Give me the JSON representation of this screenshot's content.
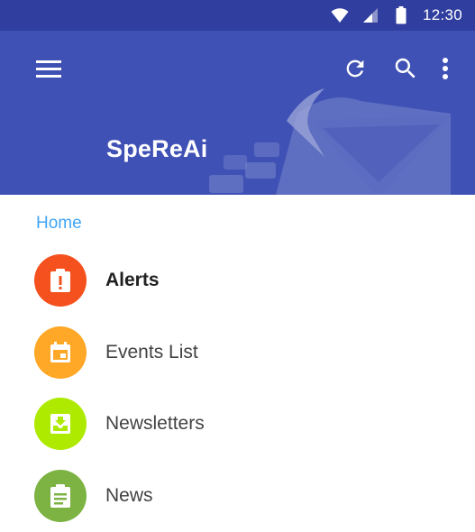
{
  "status_bar": {
    "time": "12:30",
    "icons": [
      "wifi-icon",
      "cell-signal-icon",
      "battery-icon"
    ]
  },
  "app_bar": {
    "title": "SpeReAi",
    "icons": [
      "menu-icon",
      "refresh-icon",
      "search-icon",
      "more-vert-icon"
    ]
  },
  "drawer": {
    "section_label": "Home",
    "items": [
      {
        "label": "Alerts",
        "icon": "alert-clipboard-icon",
        "color": "#f4511e",
        "active": true
      },
      {
        "label": "Events List",
        "icon": "calendar-icon",
        "color": "#ffa726",
        "active": false
      },
      {
        "label": "Newsletters",
        "icon": "inbox-download-icon",
        "color": "#aeea00",
        "active": false
      },
      {
        "label": "News",
        "icon": "clipboard-text-icon",
        "color": "#7cb342",
        "active": false
      }
    ]
  },
  "colors": {
    "status_bar": "#303f9f",
    "app_bar": "#3f51b5",
    "section_label": "#42a5f5"
  }
}
